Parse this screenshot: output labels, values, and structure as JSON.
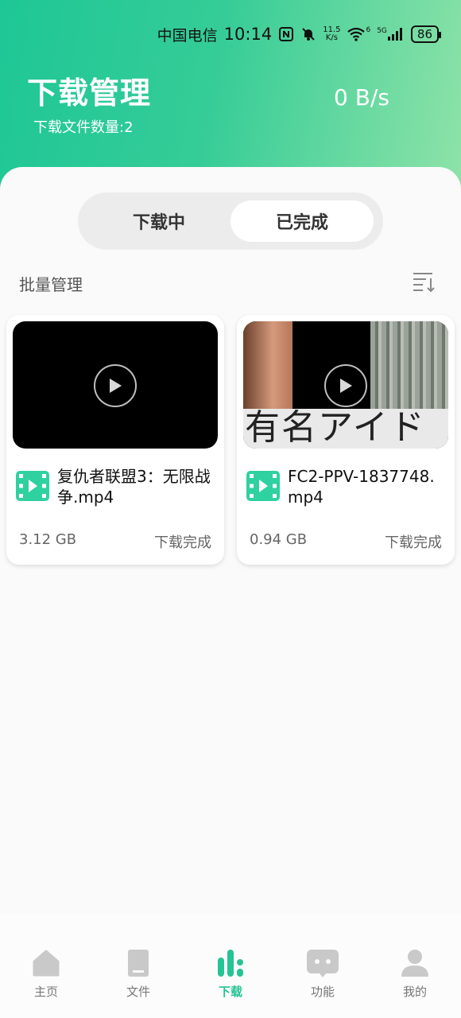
{
  "status_bar": {
    "carrier": "中国电信",
    "time": "10:14",
    "net_speed_value": "11.5",
    "net_speed_unit": "K/s",
    "wifi_badge": "6",
    "signal_badge": "5G",
    "battery": "86"
  },
  "header": {
    "title": "下载管理",
    "file_count_label": "下载文件数量:2",
    "speed": "0 B/s"
  },
  "tabs": [
    {
      "label": "下载中",
      "active": false
    },
    {
      "label": "已完成",
      "active": true
    }
  ],
  "batch_manage_label": "批量管理",
  "files": [
    {
      "name": "复仇者联盟3：无限战争.mp4",
      "size": "3.12 GB",
      "status": "下载完成"
    },
    {
      "name": "FC2-PPV-1837748.mp4",
      "size": "0.94 GB",
      "status": "下载完成",
      "thumbnail_text": "有名アイド"
    }
  ],
  "nav": [
    {
      "label": "主页",
      "icon": "home-icon",
      "active": false
    },
    {
      "label": "文件",
      "icon": "book-icon",
      "active": false
    },
    {
      "label": "下载",
      "icon": "bar-chart-icon",
      "active": true
    },
    {
      "label": "功能",
      "icon": "chat-icon",
      "active": false
    },
    {
      "label": "我的",
      "icon": "user-icon",
      "active": false
    }
  ],
  "colors": {
    "accent": "#26c394",
    "header_gradient_start": "#1ec796",
    "header_gradient_end": "#8fe3a8"
  }
}
